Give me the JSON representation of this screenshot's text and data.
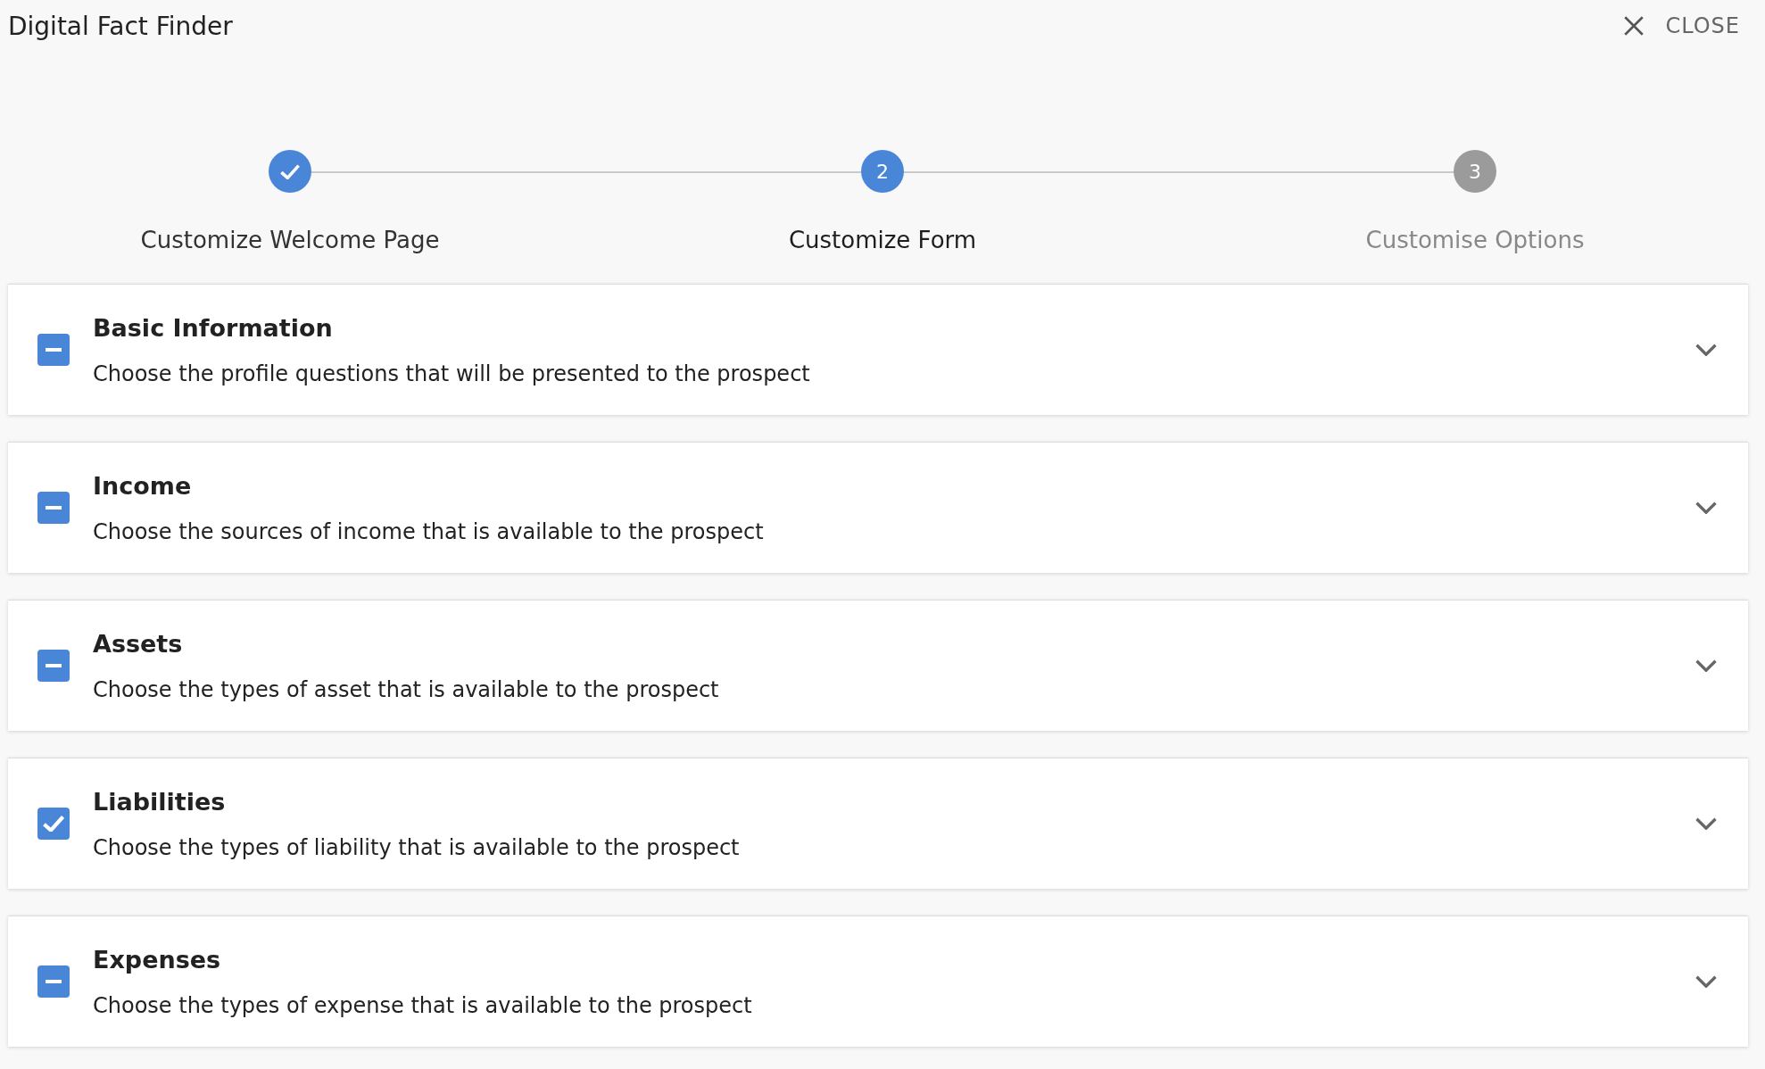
{
  "window": {
    "title": "Digital Fact Finder",
    "close_label": "CLOSE"
  },
  "steps": [
    {
      "label": "Customize Welcome Page",
      "done": true,
      "selected": false
    },
    {
      "number": "2",
      "label": "Customize Form",
      "done": false,
      "selected": true
    },
    {
      "number": "3",
      "label": "Customise Options",
      "done": false,
      "selected": false
    }
  ],
  "sections": [
    {
      "title": "Basic Information",
      "description": "Choose the profile questions that will be presented to the prospect",
      "checked": false,
      "indeterminate": true
    },
    {
      "title": "Income",
      "description": "Choose the sources of income that is available to the prospect",
      "checked": false,
      "indeterminate": true
    },
    {
      "title": "Assets",
      "description": "Choose the types of asset that is available to the prospect",
      "checked": false,
      "indeterminate": true
    },
    {
      "title": "Liabilities",
      "description": "Choose the types of liability that is available to the prospect",
      "checked": true
    },
    {
      "title": "Expenses",
      "description": "Choose the types of expense that is available to the prospect",
      "checked": false,
      "indeterminate": true
    }
  ]
}
